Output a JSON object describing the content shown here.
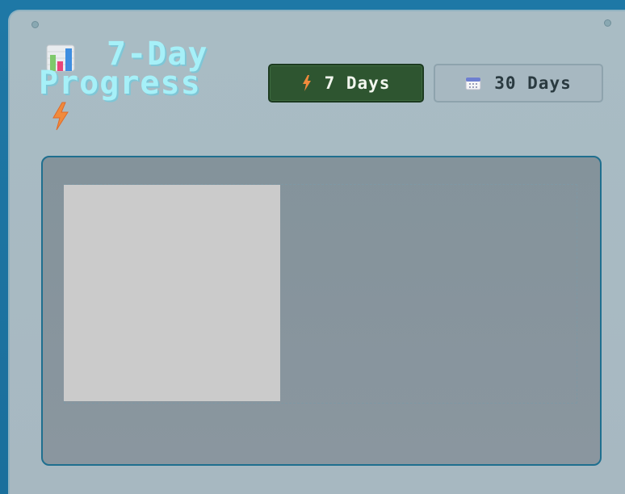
{
  "header": {
    "title_line1": "7-Day",
    "title_line2": "Progress"
  },
  "icons": {
    "title_icon": "bar-chart-emoji-icon",
    "title_bolt": "lightning-bolt-icon"
  },
  "range_buttons": [
    {
      "label": "7 Days",
      "icon": "lightning-bolt-icon",
      "active": true
    },
    {
      "label": "30 Days",
      "icon": "calendar-icon",
      "active": false
    }
  ],
  "colors": {
    "title": "#a6f0f8",
    "active_button_bg": "#2e5530",
    "inactive_button_bg": "#a7b8c1",
    "chart_border": "#1f6f8f",
    "panel_bg": "#a9bcc4"
  }
}
